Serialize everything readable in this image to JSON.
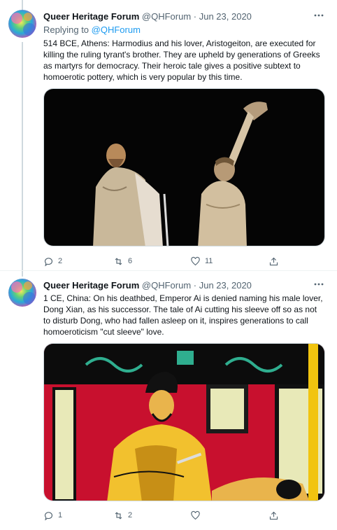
{
  "tweets": [
    {
      "name": "Queer Heritage Forum",
      "handle": "@QHForum",
      "date": "· Jun 23, 2020",
      "reply_prefix": "Replying to ",
      "reply_handle": "@QHForum",
      "text": "514 BCE, Athens: Harmodius and his lover, Aristogeiton, are executed for killing the ruling tyrant's brother. They are upheld by generations of Greeks as martyrs for democracy. Their heroic tale gives a positive subtext to homoerotic pottery, which is very popular by this time.",
      "replies": "2",
      "retweets": "6",
      "likes": "11"
    },
    {
      "name": "Queer Heritage Forum",
      "handle": "@QHForum",
      "date": "· Jun 23, 2020",
      "text": "1 CE, China: On his deathbed, Emperor Ai is denied naming his male lover, Dong Xian, as his successor. The tale of Ai cutting his sleeve off so as not to disturb Dong, who had fallen asleep on it, inspires generations to call homoeroticism \"cut sleeve\" love.",
      "replies": "1",
      "retweets": "2",
      "likes": ""
    }
  ],
  "icons": {
    "reply": "reply-icon",
    "retweet": "retweet-icon",
    "like": "heart-icon",
    "share": "share-icon",
    "more": "more-icon"
  },
  "colors": {
    "link": "#1d9bf0",
    "secondary": "#536471",
    "border": "#cfd9de"
  }
}
